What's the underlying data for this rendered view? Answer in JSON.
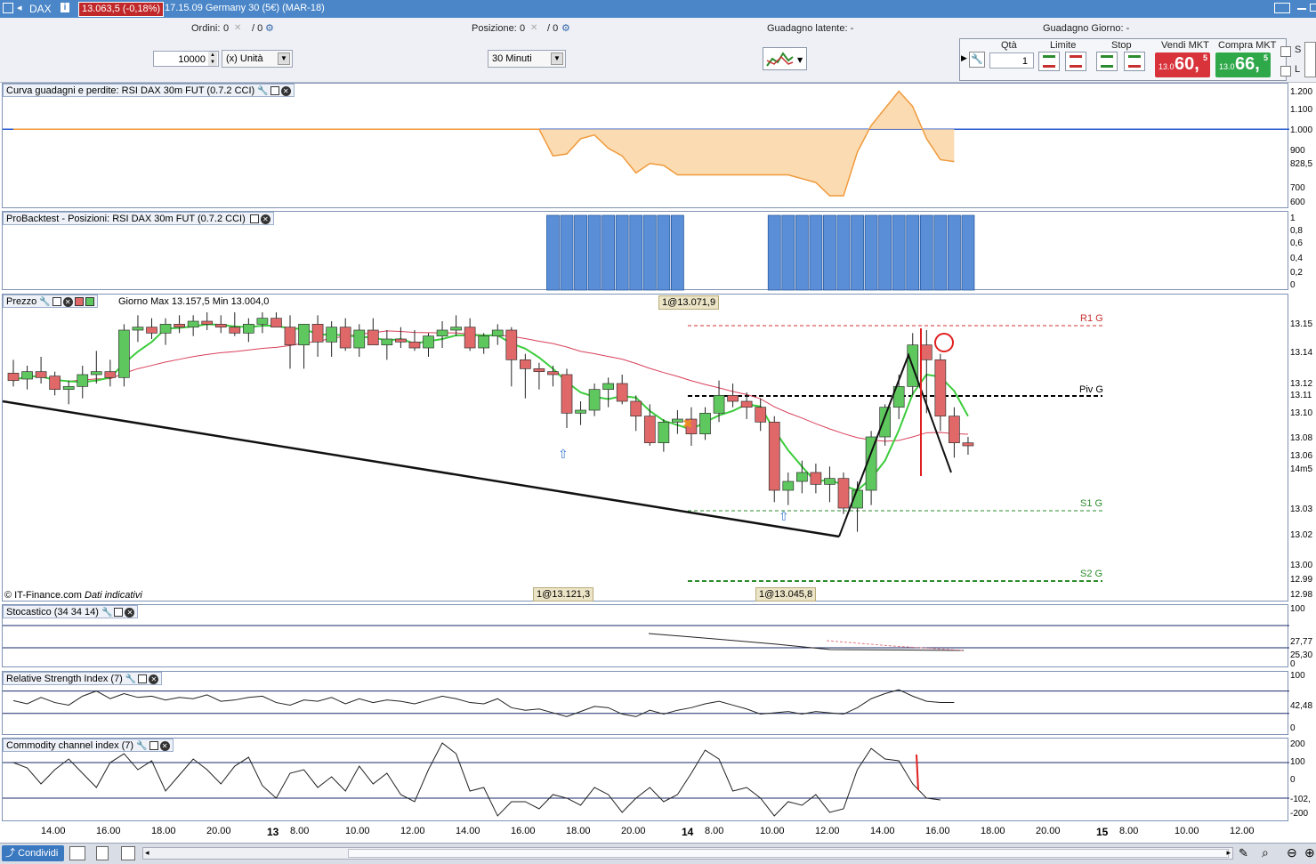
{
  "window": {
    "symbol": "DAX",
    "info_icon": "info-icon",
    "price_badge": "13.063,5 (-0,18%)",
    "subtitle": "17.15.09 Germany 30 (5€) (MAR-18)"
  },
  "toolbar": {
    "ordini_label": "Ordini:",
    "ordini_value": "0",
    "ordini_value2": "/ 0",
    "posizione_label": "Posizione:",
    "posizione_value": "0",
    "posizione_value2": "/ 0",
    "guadagno_latente": "Guadagno latente: -",
    "guadagno_giorno": "Guadagno Giorno: -",
    "quantity": "10000",
    "unit_select": "(x) Unità",
    "timeframe_select": "30 Minuti",
    "qta_label": "Qtà",
    "qta_value": "1",
    "limite_label": "Limite",
    "stop_label": "Stop",
    "vendi_label": "Vendi MKT",
    "compra_label": "Compra MKT",
    "vendi_small": "13.0",
    "vendi_big": "60,",
    "vendi_sup": "5",
    "compra_small": "13.0",
    "compra_big": "66,",
    "compra_sup": "5",
    "s_label": "S",
    "l_label": "L"
  },
  "panels": {
    "equity_title": "Curva guadagni e perdite: RSI DAX 30m FUT (0.7.2 CCI)",
    "positions_title": "ProBacktest - Posizioni: RSI DAX 30m FUT (0.7.2 CCI)",
    "price_title": "Prezzo",
    "price_info": "Giorno Max 13.157,5 Min 13.004,0",
    "stoch_title": "Stocastico (34 34 14)",
    "rsi_title": "Relative Strength Index (7)",
    "cci_title": "Commodity channel index (7)"
  },
  "annotations": {
    "top_trade": "1@13.071,9",
    "bottom_trade1": "1@13.121,3",
    "bottom_trade2": "1@13.045,8",
    "copyright": "© IT-Finance.com",
    "dati": "Dati indicativi",
    "r1": "R1 G",
    "piv": "Piv G",
    "s1": "S1 G",
    "s2": "S2 G"
  },
  "axes": {
    "equity": [
      "1.200",
      "1.100",
      "1.000",
      "900",
      "828,5",
      "700",
      "600"
    ],
    "positions": [
      "1",
      "0,8",
      "0,6",
      "0,4",
      "0,2",
      "0"
    ],
    "price": [
      "13.15",
      "13.14",
      "13.12",
      "13.11",
      "13.10",
      "13.08",
      "13.06",
      "14m5",
      "13.03",
      "13.02",
      "13.00",
      "12.99",
      "12.98"
    ],
    "stoch": [
      "100",
      "27,77",
      "25,30",
      "0"
    ],
    "rsi": [
      "100",
      "42,48",
      "0"
    ],
    "cci": [
      "200",
      "100",
      "0",
      "-102,",
      "-200"
    ]
  },
  "time_axis": [
    "14.00",
    "16.00",
    "18.00",
    "20.00",
    "13",
    "8.00",
    "10.00",
    "12.00",
    "14.00",
    "16.00",
    "18.00",
    "20.00",
    "14",
    "8.00",
    "10.00",
    "12.00",
    "14.00",
    "16.00",
    "18.00",
    "20.00",
    "15",
    "8.00",
    "10.00",
    "12.00"
  ],
  "bottom": {
    "share": "Condividi"
  },
  "colors": {
    "title_bar": "#4a86c8",
    "sell": "#d8333a",
    "buy": "#2fa84a",
    "bull_candle": "#5ec85e",
    "bear_candle": "#e06868",
    "equity_fill": "#fbd7a8",
    "position_bar": "#5a8fd8"
  },
  "chart_data": {
    "type": "candlestick",
    "ylim": [
      12980,
      13160
    ],
    "candles": [
      [
        13119,
        13128,
        13110,
        13114
      ],
      [
        13115,
        13124,
        13108,
        13120
      ],
      [
        13120,
        13130,
        13112,
        13116
      ],
      [
        13117,
        13120,
        13104,
        13108
      ],
      [
        13108,
        13114,
        13098,
        13110
      ],
      [
        13110,
        13124,
        13102,
        13118
      ],
      [
        13118,
        13134,
        13112,
        13120
      ],
      [
        13120,
        13128,
        13110,
        13116
      ],
      [
        13116,
        13152,
        13110,
        13148
      ],
      [
        13148,
        13158,
        13140,
        13150
      ],
      [
        13150,
        13156,
        13142,
        13146
      ],
      [
        13146,
        13156,
        13138,
        13152
      ],
      [
        13152,
        13158,
        13146,
        13150
      ],
      [
        13150,
        13158,
        13144,
        13154
      ],
      [
        13154,
        13160,
        13148,
        13152
      ],
      [
        13152,
        13158,
        13146,
        13150
      ],
      [
        13150,
        13160,
        13144,
        13146
      ],
      [
        13146,
        13156,
        13140,
        13152
      ],
      [
        13152,
        13160,
        13146,
        13156
      ],
      [
        13156,
        13160,
        13150,
        13150
      ],
      [
        13150,
        13158,
        13122,
        13138
      ],
      [
        13138,
        13150,
        13122,
        13152
      ],
      [
        13152,
        13158,
        13130,
        13140
      ],
      [
        13140,
        13154,
        13130,
        13150
      ],
      [
        13150,
        13156,
        13134,
        13136
      ],
      [
        13136,
        13152,
        13130,
        13148
      ],
      [
        13148,
        13156,
        13138,
        13138
      ],
      [
        13138,
        13148,
        13128,
        13142
      ],
      [
        13142,
        13150,
        13136,
        13140
      ],
      [
        13140,
        13148,
        13134,
        13136
      ],
      [
        13136,
        13146,
        13130,
        13144
      ],
      [
        13144,
        13154,
        13136,
        13148
      ],
      [
        13148,
        13158,
        13144,
        13150
      ],
      [
        13150,
        13156,
        13134,
        13136
      ],
      [
        13136,
        13146,
        13132,
        13144
      ],
      [
        13144,
        13152,
        13138,
        13148
      ],
      [
        13148,
        13150,
        13110,
        13128
      ],
      [
        13128,
        13132,
        13102,
        13122
      ],
      [
        13122,
        13126,
        13108,
        13120
      ],
      [
        13120,
        13124,
        13110,
        13118
      ],
      [
        13118,
        13122,
        13082,
        13092
      ],
      [
        13092,
        13100,
        13084,
        13094
      ],
      [
        13094,
        13112,
        13090,
        13108
      ],
      [
        13108,
        13116,
        13096,
        13112
      ],
      [
        13112,
        13118,
        13098,
        13100
      ],
      [
        13100,
        13104,
        13080,
        13090
      ],
      [
        13090,
        13098,
        13070,
        13072
      ],
      [
        13072,
        13088,
        13066,
        13086
      ],
      [
        13086,
        13094,
        13078,
        13088
      ],
      [
        13088,
        13096,
        13070,
        13078
      ],
      [
        13078,
        13096,
        13074,
        13092
      ],
      [
        13092,
        13114,
        13086,
        13104
      ],
      [
        13104,
        13112,
        13096,
        13100
      ],
      [
        13100,
        13106,
        13088,
        13096
      ],
      [
        13096,
        13102,
        13080,
        13086
      ],
      [
        13086,
        13090,
        13032,
        13040
      ],
      [
        13040,
        13052,
        13030,
        13046
      ],
      [
        13046,
        13060,
        13038,
        13052
      ],
      [
        13052,
        13058,
        13038,
        13044
      ],
      [
        13044,
        13056,
        13032,
        13048
      ],
      [
        13048,
        13052,
        13024,
        13028
      ],
      [
        13028,
        13046,
        13012,
        13040
      ],
      [
        13040,
        13080,
        13030,
        13076
      ],
      [
        13076,
        13098,
        13070,
        13096
      ],
      [
        13096,
        13118,
        13088,
        13110
      ],
      [
        13110,
        13146,
        13104,
        13138
      ],
      [
        13138,
        13148,
        13092,
        13128
      ],
      [
        13128,
        13132,
        13080,
        13090
      ],
      [
        13090,
        13096,
        13062,
        13072
      ],
      [
        13072,
        13076,
        13064,
        13070
      ]
    ],
    "equity_curve": [
      1000,
      1000,
      1000,
      1000,
      1000,
      1000,
      1000,
      1000,
      1000,
      1000,
      1000,
      1000,
      1000,
      1000,
      1000,
      1000,
      1000,
      1000,
      1000,
      1000,
      1000,
      1000,
      1000,
      1000,
      1000,
      1000,
      1000,
      1000,
      1000,
      1000,
      1000,
      1000,
      1000,
      1000,
      1000,
      1000,
      1000,
      1000,
      1000,
      860,
      870,
      950,
      970,
      900,
      860,
      770,
      820,
      810,
      760,
      760,
      760,
      760,
      760,
      760,
      760,
      760,
      760,
      740,
      720,
      650,
      650,
      880,
      1020,
      1110,
      1200,
      1120,
      950,
      840,
      830
    ],
    "position_bars": [
      0,
      0,
      0,
      0,
      0,
      0,
      0,
      0,
      0,
      0,
      0,
      0,
      0,
      0,
      0,
      0,
      0,
      0,
      0,
      0,
      0,
      0,
      0,
      0,
      0,
      0,
      0,
      0,
      0,
      0,
      0,
      0,
      0,
      0,
      0,
      0,
      0,
      0,
      0,
      1,
      1,
      1,
      1,
      1,
      1,
      1,
      1,
      1,
      1,
      0,
      0,
      0,
      0,
      0,
      0,
      1,
      1,
      1,
      1,
      1,
      1,
      1,
      1,
      1,
      1,
      1,
      1,
      1,
      1,
      1
    ],
    "rsi": [
      55,
      50,
      60,
      52,
      48,
      62,
      70,
      58,
      66,
      60,
      62,
      56,
      60,
      58,
      64,
      54,
      56,
      60,
      62,
      52,
      48,
      56,
      54,
      60,
      50,
      58,
      52,
      56,
      54,
      50,
      56,
      62,
      58,
      52,
      50,
      58,
      44,
      40,
      42,
      36,
      30,
      38,
      46,
      44,
      34,
      30,
      40,
      34,
      40,
      44,
      50,
      54,
      48,
      42,
      34,
      36,
      38,
      34,
      38,
      36,
      34,
      44,
      58,
      66,
      72,
      62,
      54,
      52,
      52
    ],
    "cci": [
      100,
      70,
      -20,
      60,
      120,
      40,
      -40,
      100,
      150,
      60,
      110,
      -60,
      30,
      120,
      60,
      -20,
      80,
      130,
      -30,
      -100,
      40,
      60,
      -40,
      20,
      -60,
      80,
      -20,
      40,
      -80,
      -120,
      60,
      210,
      150,
      -60,
      -40,
      -200,
      -120,
      -120,
      -160,
      -80,
      -100,
      -140,
      -40,
      -80,
      -180,
      -100,
      -40,
      -120,
      -80,
      40,
      170,
      120,
      -60,
      -40,
      -100,
      -200,
      -120,
      -140,
      -80,
      -180,
      -160,
      60,
      180,
      120,
      110,
      -20,
      -100,
      -110
    ]
  }
}
